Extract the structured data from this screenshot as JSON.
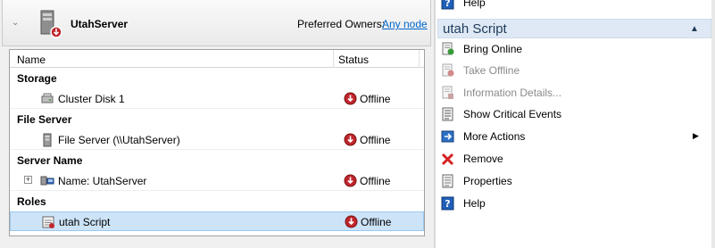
{
  "header": {
    "server_name": "UtahServer",
    "preferred_owners_label": "Preferred Owners:",
    "preferred_owners_link": "Any node"
  },
  "grid": {
    "columns": {
      "name": "Name",
      "status": "Status"
    },
    "groups": {
      "storage": "Storage",
      "file_server": "File Server",
      "server_name": "Server Name",
      "roles": "Roles"
    },
    "rows": {
      "cluster_disk": {
        "name": "Cluster Disk 1",
        "status": "Offline"
      },
      "file_server": {
        "name": "File Server (\\\\UtahServer)",
        "status": "Offline"
      },
      "name_resource": {
        "name": "Name: UtahServer",
        "status": "Offline"
      },
      "script": {
        "name": "utah Script",
        "status": "Offline"
      }
    }
  },
  "actions": {
    "top_help": "Help",
    "section_title": "utah Script",
    "items": {
      "bring_online": "Bring Online",
      "take_offline": "Take Offline",
      "information_details": "Information Details...",
      "show_critical_events": "Show Critical Events",
      "more_actions": "More Actions",
      "remove": "Remove",
      "properties": "Properties",
      "help": "Help"
    }
  },
  "colors": {
    "link": "#0066cc",
    "selected_row": "#cde3f7",
    "offline_icon": "#c0272d",
    "section_header": "#dfe9f5"
  }
}
